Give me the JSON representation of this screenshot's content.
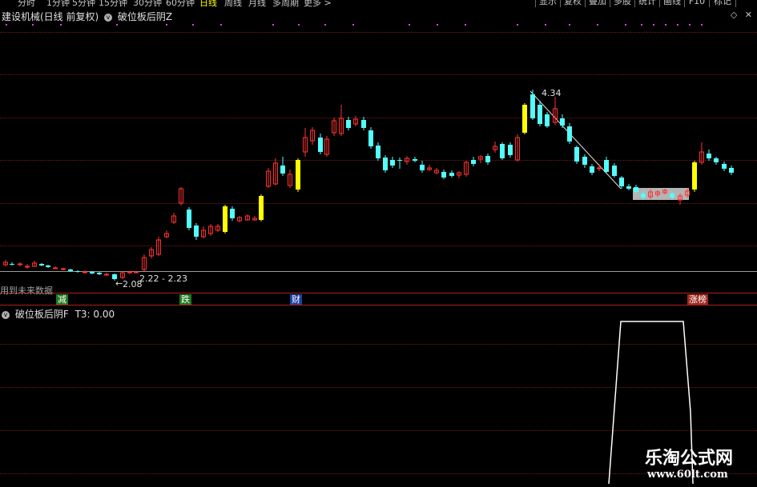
{
  "toolbar": {
    "tabs": [
      "分时",
      "1分钟",
      "5分钟",
      "15分钟",
      "30分钟",
      "60分钟",
      "日线",
      "周线",
      "月线",
      "多周期",
      "更多 >"
    ],
    "active_tab": "日线",
    "right_buttons": [
      "显示",
      "复权",
      "叠加",
      "多股",
      "统计",
      "画线",
      "F10",
      "标记"
    ]
  },
  "header": {
    "stock_title": "建设机械(日线 前复权)",
    "formula_name": "破位板后阴Z",
    "icons": [
      "diamond-icon",
      "close-icon"
    ]
  },
  "main_chart": {
    "price_labels": {
      "high": "4.34",
      "low": "2.08",
      "range": "2.22 - 2.23"
    },
    "future_data_label": "用到未来数据",
    "badges": [
      {
        "text": "减",
        "color": "#1f7a1f"
      },
      {
        "text": "跌",
        "color": "#1f7a1f"
      },
      {
        "text": "财",
        "color": "#1f3fa0"
      },
      {
        "text": "涨榜",
        "color": "#a0281f"
      }
    ],
    "colors": {
      "up": "#ff3232",
      "down": "#54fcfc",
      "limit": "#ffff00",
      "box": "#b4b4b4"
    }
  },
  "indicator": {
    "title": "破位板后阴F",
    "value_label": "T3: 0.00",
    "colors": {
      "line": "#ffffff"
    }
  },
  "watermark": {
    "line1": "乐淘公式网",
    "line2": "www.60lt.com"
  }
}
